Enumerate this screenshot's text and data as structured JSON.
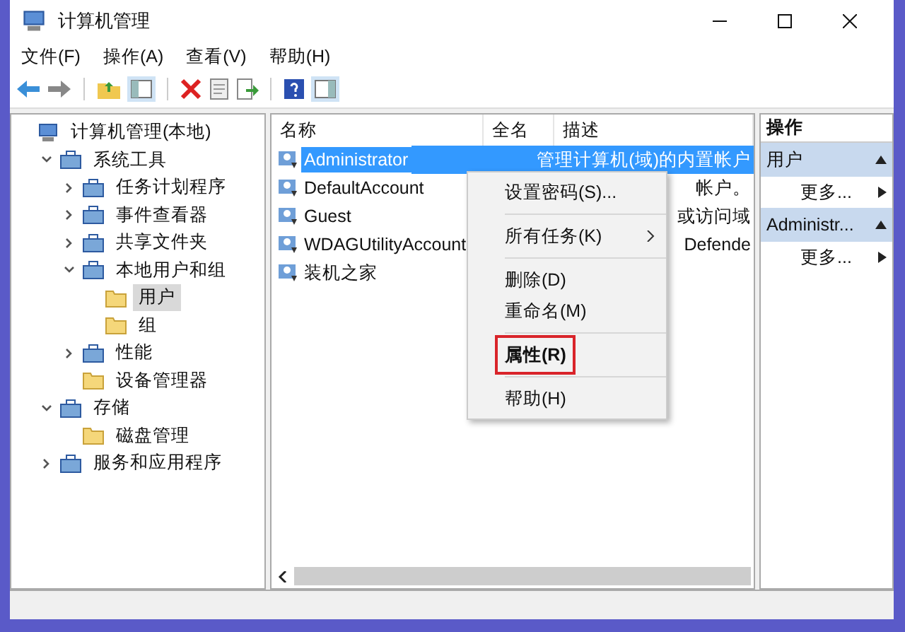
{
  "window": {
    "title": "计算机管理"
  },
  "menu": [
    "文件(F)",
    "操作(A)",
    "查看(V)",
    "帮助(H)"
  ],
  "tree": [
    {
      "label": "计算机管理(本地)",
      "kind": "root",
      "selected": false,
      "children": [
        {
          "label": "系统工具",
          "kind": "branch",
          "expanded": true,
          "selected": false,
          "children": [
            {
              "label": "任务计划程序",
              "kind": "branch",
              "expanded": false,
              "selected": false
            },
            {
              "label": "事件查看器",
              "kind": "branch",
              "expanded": false,
              "selected": false
            },
            {
              "label": "共享文件夹",
              "kind": "branch",
              "expanded": false,
              "selected": false
            },
            {
              "label": "本地用户和组",
              "kind": "branch",
              "expanded": true,
              "selected": false,
              "children": [
                {
                  "label": "用户",
                  "kind": "leaf",
                  "selected": true
                },
                {
                  "label": "组",
                  "kind": "leaf",
                  "selected": false
                }
              ]
            },
            {
              "label": "性能",
              "kind": "branch",
              "expanded": false,
              "selected": false
            },
            {
              "label": "设备管理器",
              "kind": "leaf",
              "selected": false
            }
          ]
        },
        {
          "label": "存储",
          "kind": "branch",
          "expanded": true,
          "selected": false,
          "children": [
            {
              "label": "磁盘管理",
              "kind": "leaf",
              "selected": false
            }
          ]
        },
        {
          "label": "服务和应用程序",
          "kind": "branch",
          "expanded": false,
          "selected": false
        }
      ]
    }
  ],
  "list": {
    "columns": [
      "名称",
      "全名",
      "描述"
    ],
    "rows": [
      {
        "name": "Administrator",
        "description": "管理计算机(域)的内置帐户",
        "selected": true
      },
      {
        "name": "DefaultAccount",
        "description": "帐户。",
        "selected": false
      },
      {
        "name": "Guest",
        "description": "或访问域",
        "selected": false
      },
      {
        "name": "WDAGUtilityAccount",
        "description": "Defende",
        "selected": false
      },
      {
        "name": "装机之家",
        "selected": false
      }
    ]
  },
  "context_menu": [
    {
      "kind": "item",
      "label": "设置密码(S)...",
      "emphasized": false
    },
    {
      "kind": "separator"
    },
    {
      "kind": "submenu",
      "label": "所有任务(K)",
      "emphasized": false
    },
    {
      "kind": "separator"
    },
    {
      "kind": "item",
      "label": "删除(D)",
      "emphasized": false
    },
    {
      "kind": "item",
      "label": "重命名(M)",
      "emphasized": false
    },
    {
      "kind": "separator"
    },
    {
      "kind": "item",
      "label": "属性(R)",
      "emphasized": true
    },
    {
      "kind": "separator"
    },
    {
      "kind": "item",
      "label": "帮助(H)",
      "emphasized": false
    }
  ],
  "actions": {
    "title": "操作",
    "sections": [
      {
        "title": "用户",
        "items": [
          "更多..."
        ]
      },
      {
        "title": "Administr...",
        "items": [
          "更多..."
        ]
      }
    ]
  }
}
